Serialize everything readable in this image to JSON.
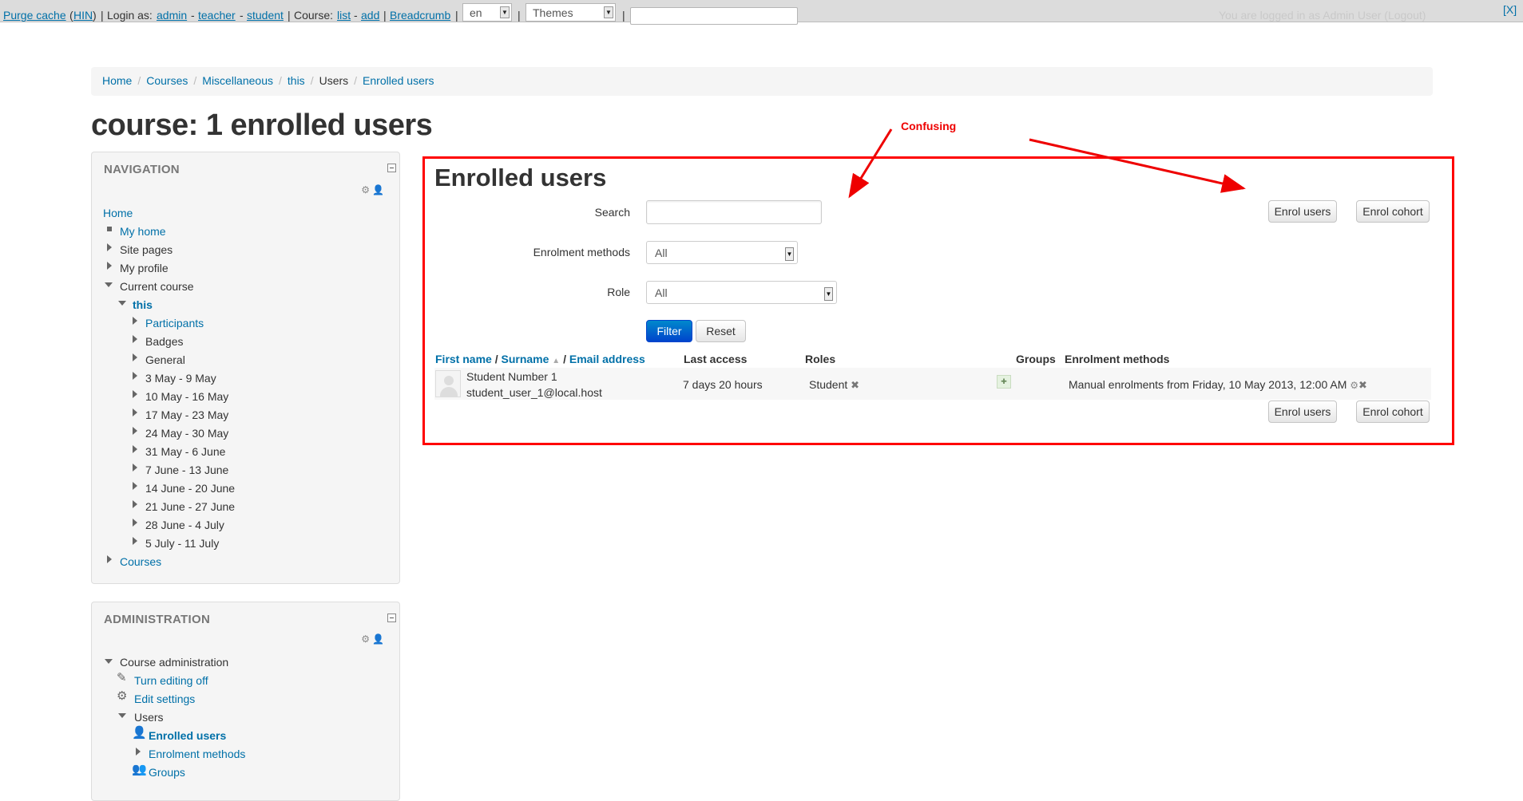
{
  "devbar": {
    "purge_cache": "Purge cache",
    "hin": "HIN",
    "login_as_label": "Login as:",
    "admin": "admin",
    "teacher": "teacher",
    "student": "student",
    "course_label": "Course:",
    "list": "list",
    "add": "add",
    "breadcrumb": "Breadcrumb",
    "lang_value": "en",
    "themes_value": "Themes",
    "logged_in_text": "You are logged in as Admin User (Logout)",
    "close_label": "[X]"
  },
  "breadcrumb": {
    "items": [
      "Home",
      "Courses",
      "Miscellaneous",
      "this",
      "Users",
      "Enrolled users"
    ]
  },
  "page_title": "course: 1 enrolled users",
  "navigation": {
    "title": "NAVIGATION",
    "items": {
      "home": "Home",
      "my_home": "My home",
      "site_pages": "Site pages",
      "my_profile": "My profile",
      "current_course": "Current course",
      "this": "this",
      "participants": "Participants",
      "badges": "Badges",
      "general": "General",
      "weeks": [
        "3 May - 9 May",
        "10 May - 16 May",
        "17 May - 23 May",
        "24 May - 30 May",
        "31 May - 6 June",
        "7 June - 13 June",
        "14 June - 20 June",
        "21 June - 27 June",
        "28 June - 4 July",
        "5 July - 11 July"
      ],
      "courses": "Courses"
    }
  },
  "administration": {
    "title": "ADMINISTRATION",
    "items": {
      "course_admin": "Course administration",
      "turn_editing_off": "Turn editing off",
      "edit_settings": "Edit settings",
      "users": "Users",
      "enrolled_users": "Enrolled users",
      "enrolment_methods": "Enrolment methods",
      "groups": "Groups"
    }
  },
  "main": {
    "heading": "Enrolled users",
    "search_label": "Search",
    "search_value": "",
    "enrol_methods_label": "Enrolment methods",
    "enrol_methods_value": "All",
    "role_label": "Role",
    "role_value": "All",
    "filter_button": "Filter",
    "reset_button": "Reset",
    "enrol_users_button": "Enrol users",
    "enrol_cohort_button": "Enrol cohort",
    "table": {
      "col_first_name": "First name",
      "col_surname": "Surname",
      "col_email": "Email address",
      "col_last_access": "Last access",
      "col_roles": "Roles",
      "col_groups": "Groups",
      "col_enrolment_methods": "Enrolment methods",
      "rows": [
        {
          "name": "Student Number 1",
          "email": "student_user_1@local.host",
          "last_access": "7 days 20 hours",
          "role": "Student",
          "enrolment": "Manual enrolments from Friday, 10 May 2013, 12:00 AM"
        }
      ]
    }
  },
  "annotation": {
    "label": "Confusing",
    "color": "#ee0000"
  }
}
